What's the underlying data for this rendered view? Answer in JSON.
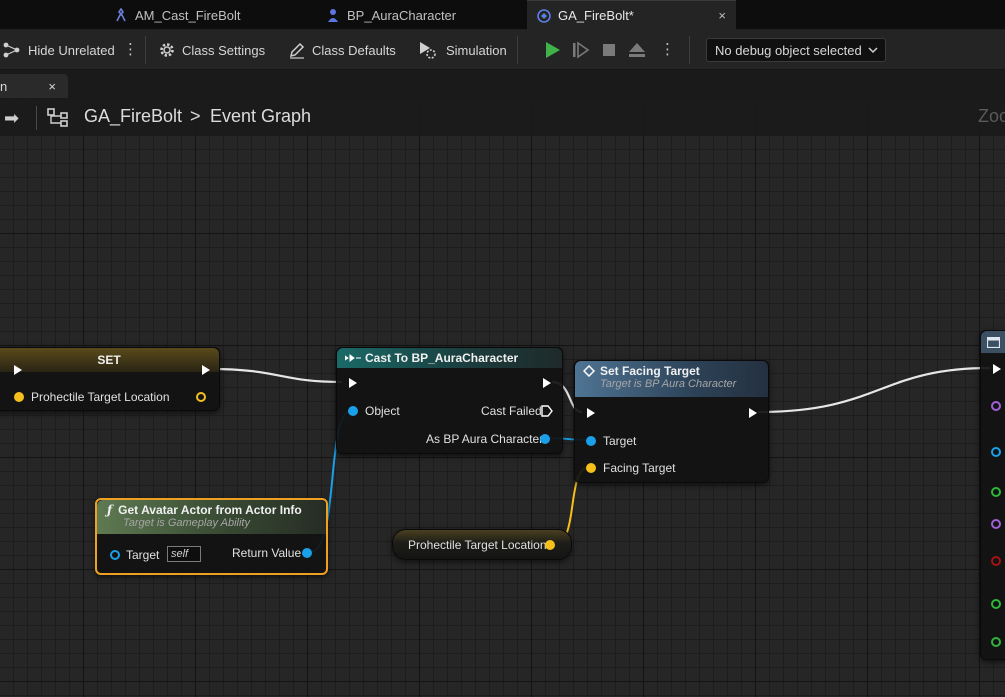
{
  "tabs": [
    {
      "label": "AM_Cast_FireBolt",
      "icon": "anim-montage-icon"
    },
    {
      "label": "BP_AuraCharacter",
      "icon": "character-icon"
    },
    {
      "label": "GA_FireBolt*",
      "icon": "blueprint-icon",
      "close": "×"
    }
  ],
  "toolbar": {
    "hide_unrelated": "Hide Unrelated",
    "class_settings": "Class Settings",
    "class_defaults": "Class Defaults",
    "simulation": "Simulation",
    "debug_object": "No debug object selected"
  },
  "panel_tab": {
    "label": "n",
    "close": "×"
  },
  "breadcrumb": {
    "graph": "GA_FireBolt",
    "separator": ">",
    "page": "Event Graph"
  },
  "zoom_label": "Zoo",
  "nodes": {
    "set": {
      "title": "SET",
      "pin": "Prohectile Target Location"
    },
    "cast": {
      "title": "Cast To BP_AuraCharacter",
      "object": "Object",
      "failed": "Cast Failed",
      "as": "As BP Aura Character"
    },
    "facing": {
      "title": "Set Facing Target",
      "subtitle": "Target is BP Aura Character",
      "target": "Target",
      "facing": "Facing Target"
    },
    "avatar": {
      "title": "Get Avatar Actor from Actor Info",
      "subtitle": "Target is Gameplay Ability",
      "target": "Target",
      "self": "self",
      "return": "Return Value"
    },
    "getter": {
      "label": "Prohectile Target Location"
    }
  },
  "colors": {
    "exec": "#ffffff",
    "object": "#1aa0e8",
    "vector": "#f5c01c",
    "purple": "#a060d8",
    "green": "#2fb53a",
    "red": "#a01414",
    "selection": "#f0a020"
  }
}
